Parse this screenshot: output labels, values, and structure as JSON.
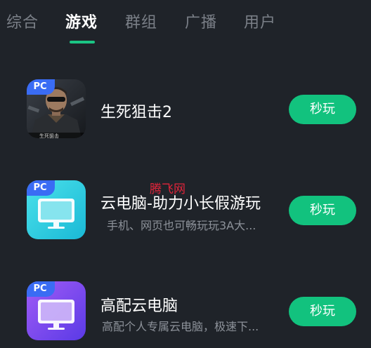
{
  "tabs": [
    {
      "label": "综合",
      "active": false
    },
    {
      "label": "游戏",
      "active": true
    },
    {
      "label": "群组",
      "active": false
    },
    {
      "label": "广播",
      "active": false
    },
    {
      "label": "用户",
      "active": false
    }
  ],
  "badge_label": "PC",
  "watermark": "腾飞网",
  "games": [
    {
      "title": "生死狙击2",
      "subtitle": "",
      "button": "秒玩",
      "icon": "soldier-game-icon"
    },
    {
      "title": "云电脑-助力小长假游玩",
      "subtitle": "手机、网页也可畅玩玩3A大...",
      "button": "秒玩",
      "icon": "cloud-pc-cyan-icon"
    },
    {
      "title": "高配云电脑",
      "subtitle": "高配个人专属云电脑，极速下...",
      "button": "秒玩",
      "icon": "cloud-pc-purple-icon"
    }
  ],
  "colors": {
    "background": "#1f2329",
    "accent": "#12c27e",
    "badge": "#3a6cf4",
    "tab_inactive": "#7a7f87",
    "subtitle": "#8d929a"
  }
}
